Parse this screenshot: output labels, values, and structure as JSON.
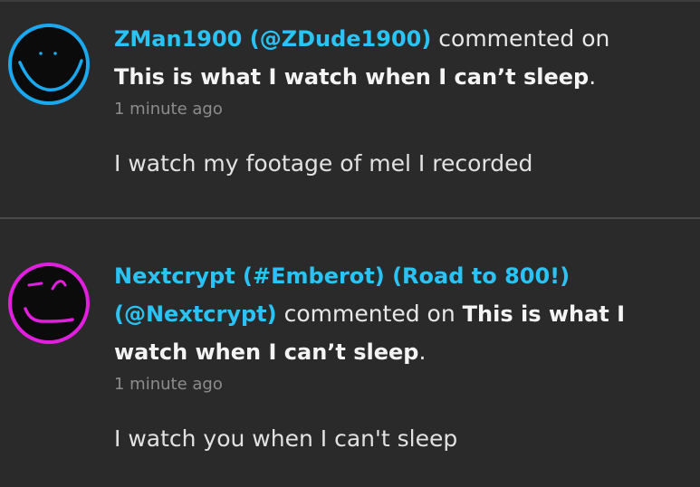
{
  "comments": [
    {
      "author": "ZMan1900 (@ZDude1900)",
      "action": "commented on",
      "post_title": "This is what I watch when I can’t sleep",
      "period": ".",
      "timestamp": "1 minute ago",
      "text": "I watch my footage of mel I recorded",
      "avatar_icon": "smiley-face-blue-icon",
      "avatar_color": "#1aa8f0"
    },
    {
      "author": "Nextcrypt (#Emberot) (Road to 800!) (@Nextcrypt)",
      "action": "commented on",
      "post_title": "This is what I watch when I can’t sleep",
      "period": ".",
      "timestamp": "1 minute ago",
      "text": "I watch you when I can't sleep",
      "avatar_icon": "smirk-face-magenta-icon",
      "avatar_color": "#e21fe0"
    }
  ]
}
